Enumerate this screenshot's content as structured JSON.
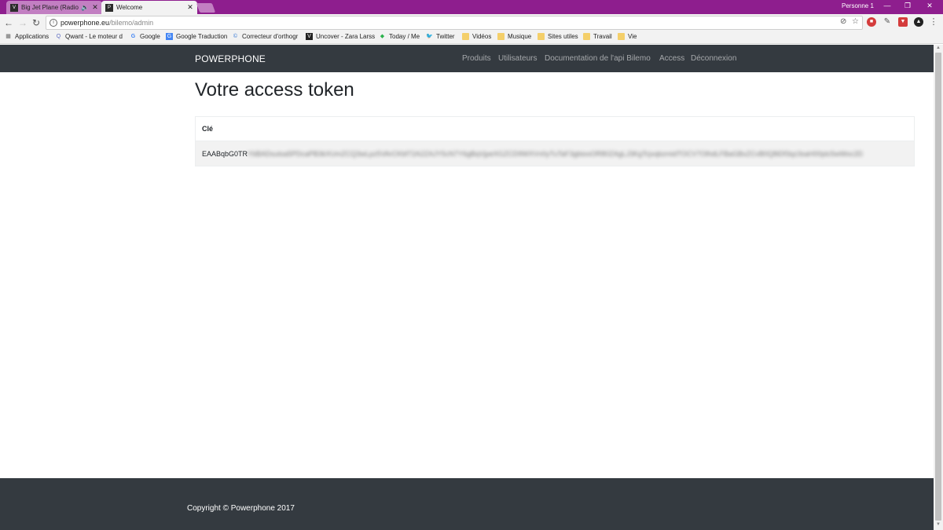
{
  "browser": {
    "tabs": [
      {
        "title": "Big Jet Plane (Radio E",
        "favicon": "vevo",
        "audio": true,
        "active": false
      },
      {
        "title": "Welcome",
        "favicon": "phpstorm",
        "audio": false,
        "active": true
      }
    ],
    "profile_name": "Personne 1",
    "window_controls": {
      "minimize": "—",
      "maximize": "❐",
      "close": "✕"
    },
    "address": {
      "host": "powerphone.eu",
      "path": "/bilemo/admin"
    },
    "bookmarks": [
      {
        "label": "Applications",
        "icon": "apps-grid-icon"
      },
      {
        "label": "Qwant - Le moteur d",
        "icon": "qwant-icon"
      },
      {
        "label": "Google",
        "icon": "google-icon"
      },
      {
        "label": "Google Traduction",
        "icon": "google-translate-icon"
      },
      {
        "label": "Correcteur d'orthogr",
        "icon": "spellcheck-icon"
      },
      {
        "label": "Uncover - Zara Larss",
        "icon": "vevo-icon"
      },
      {
        "label": "Today / Me",
        "icon": "feedly-icon"
      },
      {
        "label": "Twitter",
        "icon": "twitter-icon"
      },
      {
        "label": "Vidéos",
        "icon": "folder-icon"
      },
      {
        "label": "Musique",
        "icon": "folder-icon"
      },
      {
        "label": "Sites utiles",
        "icon": "folder-icon"
      },
      {
        "label": "Travail",
        "icon": "folder-icon"
      },
      {
        "label": "Vie",
        "icon": "folder-icon"
      }
    ]
  },
  "navbar": {
    "brand": "POWERPHONE",
    "links": [
      "Produits",
      "Utilisateurs",
      "Documentation de l'api Bilemo",
      "Access",
      "Déconnexion"
    ]
  },
  "main": {
    "heading": "Votre access token",
    "table": {
      "header": "Clé",
      "token_visible": "EAABqbG0TR",
      "token_blurred": "YbBADsutsa5PDcaPB3kXUmZCQ3wLpz5VArCKbf72A2ZAJY5cN7Y6gBqVjpeXGZCD9WXVn0yTuTaF3gbiooOR80ZAgLJ3KgTcjvqbzmidTOCV7OlhdLFBaGBxZCvB0Q8iDf3qz3saH00plc5wWoc2D"
    }
  },
  "footer": {
    "copyright": "Copyright © Powerphone 2017"
  },
  "colors": {
    "tabstrip": "#8e1e8e",
    "navbar": "#343a40",
    "footer": "#343a40"
  }
}
